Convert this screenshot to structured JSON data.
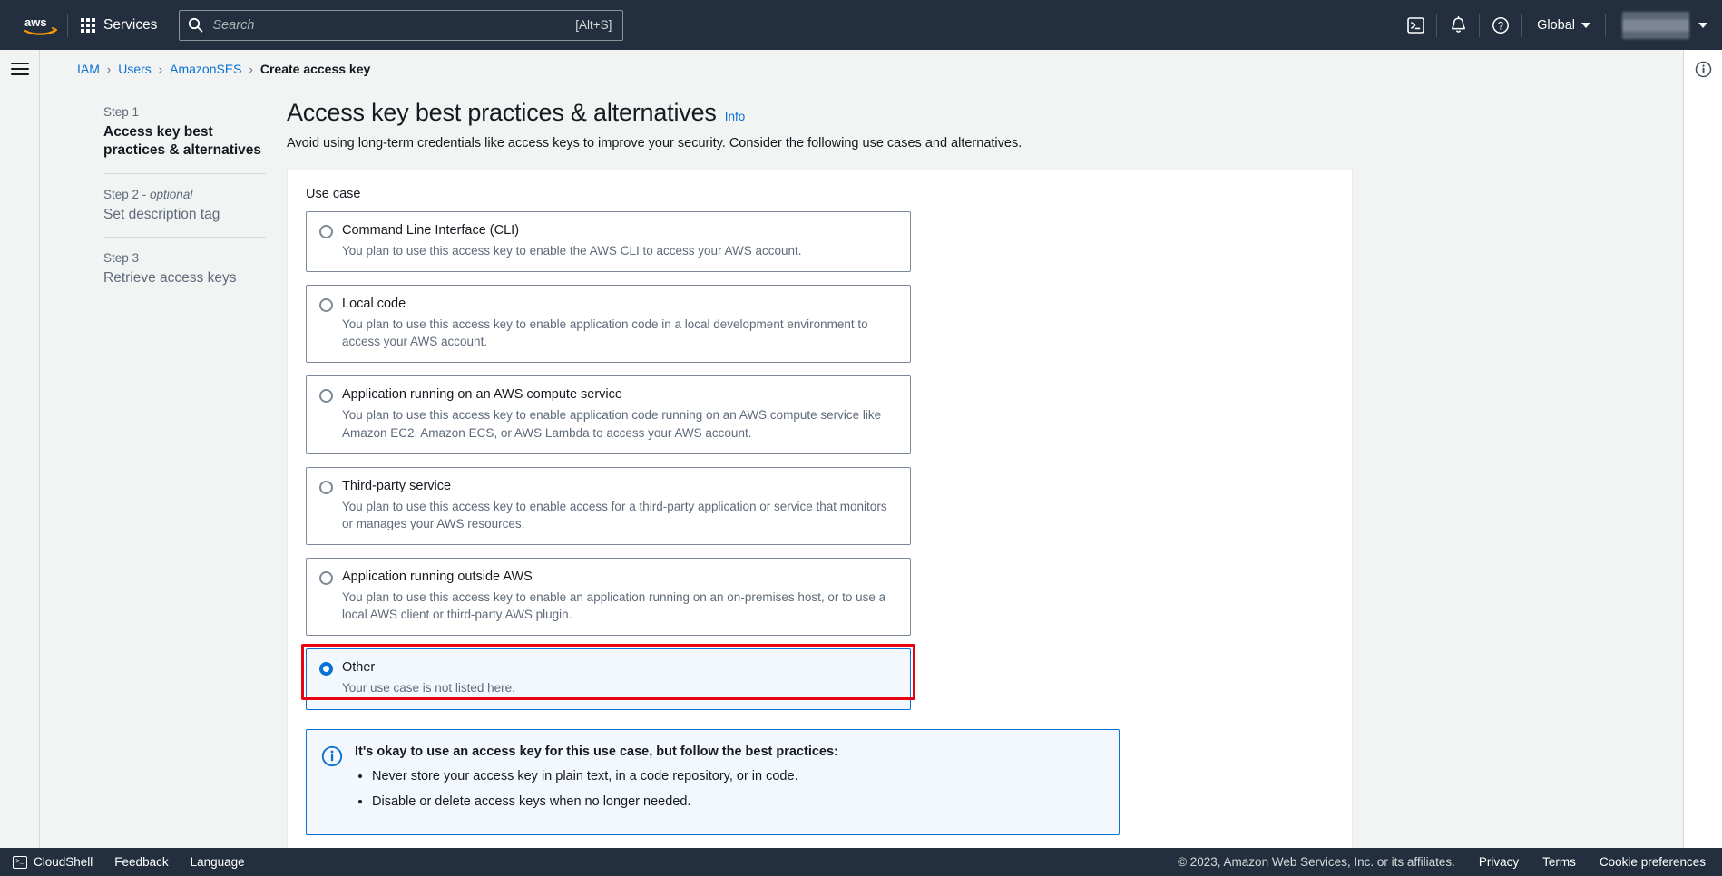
{
  "topbar": {
    "logo_alt": "aws",
    "services_label": "Services",
    "search": {
      "placeholder": "Search",
      "value": "",
      "shortcut": "[Alt+S]"
    },
    "icons": [
      "cloudshell-icon",
      "notifications-bell-icon",
      "help-question-icon"
    ],
    "region_label": "Global",
    "account_label": ""
  },
  "breadcrumb": {
    "items": [
      {
        "label": "IAM",
        "current": false
      },
      {
        "label": "Users",
        "current": false
      },
      {
        "label": "AmazonSES",
        "current": false
      },
      {
        "label": "Create access key",
        "current": true
      }
    ],
    "separator": "›"
  },
  "steps": [
    {
      "num": "Step 1",
      "optional": "",
      "title": "Access key best practices & alternatives",
      "active": true
    },
    {
      "num": "Step 2 - ",
      "optional": "optional",
      "title": "Set description tag",
      "active": false
    },
    {
      "num": "Step 3",
      "optional": "",
      "title": "Retrieve access keys",
      "active": false
    }
  ],
  "main": {
    "title": "Access key best practices & alternatives",
    "info_link": "Info",
    "description": "Avoid using long-term credentials like access keys to improve your security. Consider the following use cases and alternatives.",
    "field_label": "Use case",
    "options": [
      {
        "label": "Command Line Interface (CLI)",
        "description": "You plan to use this access key to enable the AWS CLI to access your AWS account.",
        "selected": false,
        "highlighted": false
      },
      {
        "label": "Local code",
        "description": "You plan to use this access key to enable application code in a local development environment to access your AWS account.",
        "selected": false,
        "highlighted": false
      },
      {
        "label": "Application running on an AWS compute service",
        "description": "You plan to use this access key to enable application code running on an AWS compute service like Amazon EC2, Amazon ECS, or AWS Lambda to access your AWS account.",
        "selected": false,
        "highlighted": false
      },
      {
        "label": "Third-party service",
        "description": "You plan to use this access key to enable access for a third-party application or service that monitors or manages your AWS resources.",
        "selected": false,
        "highlighted": false
      },
      {
        "label": "Application running outside AWS",
        "description": "You plan to use this access key to enable an application running on an on-premises host, or to use a local AWS client or third-party AWS plugin.",
        "selected": false,
        "highlighted": false
      },
      {
        "label": "Other",
        "description": "Your use case is not listed here.",
        "selected": true,
        "highlighted": true
      }
    ],
    "alert": {
      "icon": "info-circle-icon",
      "title": "It's okay to use an access key for this use case, but follow the best practices:",
      "bullets": [
        "Never store your access key in plain text, in a code repository, or in code.",
        "Disable or delete access keys when no longer needed."
      ]
    }
  },
  "footer": {
    "cloudshell_label": "CloudShell",
    "feedback_label": "Feedback",
    "language_label": "Language",
    "copyright": "© 2023, Amazon Web Services, Inc. or its affiliates.",
    "privacy_label": "Privacy",
    "terms_label": "Terms",
    "cookie_label": "Cookie preferences"
  },
  "colors": {
    "nav_bg": "#232f3e",
    "link": "#0972d3",
    "page_bg": "#f2f3f3",
    "highlight_border": "#e7040f",
    "selected_bg": "#f2f8fd"
  }
}
